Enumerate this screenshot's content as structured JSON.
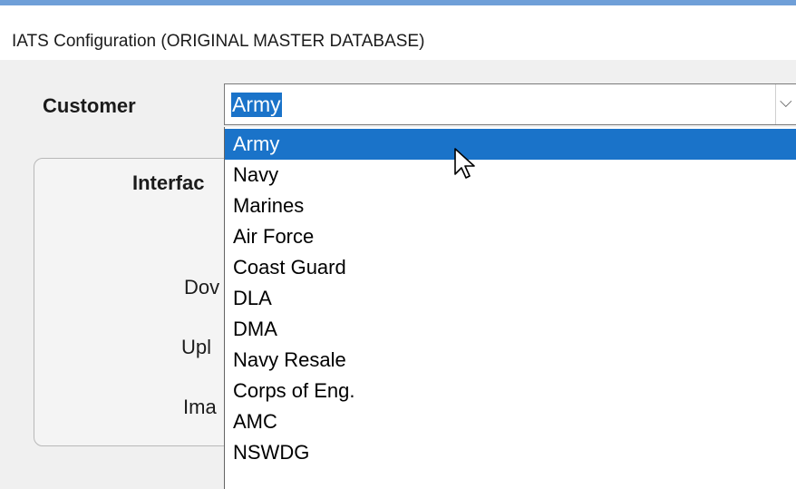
{
  "window": {
    "title": "IATS Configuration (ORIGINAL MASTER DATABASE)"
  },
  "customer": {
    "label": "Customer",
    "selected_value": "Army"
  },
  "interface_group": {
    "heading_partial": "Interfac",
    "row_labels_partial": [
      "Dov",
      "Upl",
      "Ima"
    ]
  },
  "dropdown": {
    "items": [
      "Army",
      "Navy",
      "Marines",
      "Air Force",
      "Coast Guard",
      "DLA",
      "DMA",
      "Navy Resale",
      "Corps of Eng.",
      "AMC",
      "NSWDG"
    ],
    "highlighted_item": "Army"
  },
  "colors": {
    "selection_bg": "#1a73c9",
    "selection_fg": "#ffffff",
    "window_bg": "#f0f0f0",
    "accent_border": "#6f9fd8"
  },
  "icons": {
    "combo_arrow": "chevron-down-icon",
    "cursor": "mouse-pointer-icon"
  }
}
